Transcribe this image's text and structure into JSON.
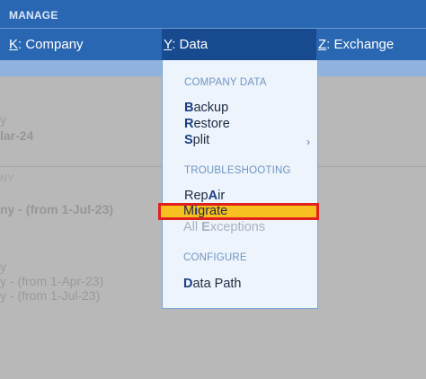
{
  "header": {
    "title": "MANAGE"
  },
  "menubar": {
    "items": [
      {
        "key": "K",
        "label": ": Company"
      },
      {
        "key": "Y",
        "label": ": Data"
      },
      {
        "key": "Z",
        "label": ": Exchange"
      }
    ]
  },
  "background": {
    "texts": [
      "y",
      "lar-24",
      "NY",
      "ny - (from 1-Jul-23)",
      "y",
      "y - (from 1-Apr-23)",
      "y - (from 1-Jul-23)"
    ]
  },
  "dropdown": {
    "sections": {
      "company_data": "COMPANY DATA",
      "troubleshooting": "TROUBLESHOOTING",
      "configure": "CONFIGURE"
    },
    "items": {
      "backup": {
        "hk": "B",
        "rest": "ackup"
      },
      "restore": {
        "hk": "R",
        "rest": "estore"
      },
      "split": {
        "hk": "S",
        "rest": "plit"
      },
      "repair": {
        "pre": "Rep",
        "hk": "A",
        "rest": "ir"
      },
      "migrate": {
        "pre": "M",
        "hk": "i",
        "rest": "grate"
      },
      "all_exceptions": {
        "pre": "All ",
        "hk": "E",
        "rest": "xceptions"
      },
      "data_path": {
        "hk": "D",
        "rest": "ata Path"
      }
    },
    "submenu_glyph": "›"
  },
  "colors": {
    "menubar": "#2a67b2",
    "active_menu": "#174a8f",
    "highlight_border": "#e0201c",
    "highlight_fill": "#f6c021"
  }
}
